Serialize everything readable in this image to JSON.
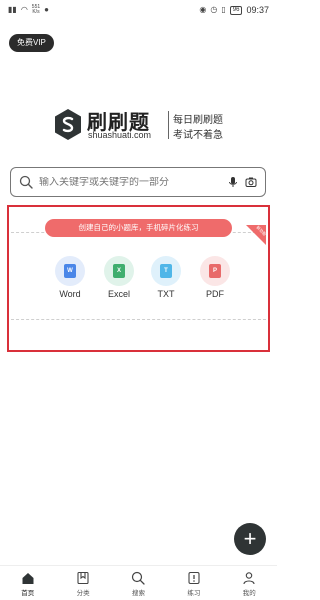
{
  "status_bar": {
    "speed_value": "551",
    "speed_unit": "K/s",
    "battery": "96",
    "time": "09:37"
  },
  "vip_button_label": "免费VIP",
  "brand": {
    "name": "刷刷题",
    "domain": "shuashuati.com",
    "slogan_line1": "每日刷刷题",
    "slogan_line2": "考试不着急"
  },
  "search": {
    "placeholder": "输入关键字或关键字的一部分"
  },
  "promo": {
    "pill_text": "创建自己的小题库，手机碎片化练习",
    "ribbon_text": "新功能"
  },
  "formats": [
    {
      "label": "Word",
      "glyph": "W",
      "bg": "#e3ecfb",
      "fg": "#4a86e8"
    },
    {
      "label": "Excel",
      "glyph": "X",
      "bg": "#e0f3ea",
      "fg": "#3fae6e"
    },
    {
      "label": "TXT",
      "glyph": "T",
      "bg": "#dff1fb",
      "fg": "#4fb6e8"
    },
    {
      "label": "PDF",
      "glyph": "P",
      "bg": "#fbe6e6",
      "fg": "#e86a6a"
    }
  ],
  "fab_label": "+",
  "bottom_nav": [
    {
      "label": "首页",
      "icon": "home-icon"
    },
    {
      "label": "分类",
      "icon": "bookmark-icon"
    },
    {
      "label": "搜索",
      "icon": "search-icon"
    },
    {
      "label": "练习",
      "icon": "practice-icon"
    },
    {
      "label": "我的",
      "icon": "profile-icon"
    }
  ],
  "colors": {
    "accent_red": "#d9303a",
    "promo_red": "#ef6b6b",
    "dark": "#2f3435"
  }
}
